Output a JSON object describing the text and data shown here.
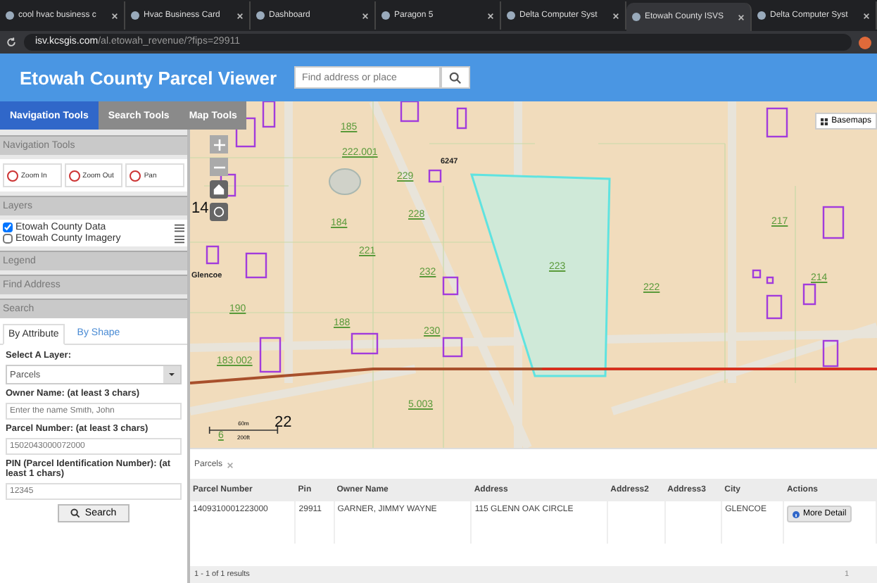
{
  "browser": {
    "tabs": [
      {
        "title": "cool hvac business c",
        "selected": false
      },
      {
        "title": "Hvac Business Card",
        "selected": false
      },
      {
        "title": "Dashboard",
        "selected": false
      },
      {
        "title": "Paragon 5",
        "selected": false
      },
      {
        "title": "Delta Computer Syst",
        "selected": false
      },
      {
        "title": "Etowah County ISVS",
        "selected": true
      },
      {
        "title": "Delta Computer Syst",
        "selected": false
      }
    ],
    "url_host": "isv.kcsgis.com",
    "url_path": "/al.etowah_revenue/?fips=29911"
  },
  "header": {
    "title": "Etowah County Parcel Viewer",
    "search_placeholder": "Find address or place"
  },
  "tool_tabs": [
    {
      "label": "Navigation Tools",
      "selected": true
    },
    {
      "label": "Search Tools",
      "selected": false
    },
    {
      "label": "Map Tools",
      "selected": false
    }
  ],
  "navigation": {
    "title": "Navigation Tools",
    "tools": [
      "Zoom In",
      "Zoom Out",
      "Pan"
    ]
  },
  "layers": {
    "title": "Layers",
    "items": [
      {
        "label": "Etowah County Data",
        "checked": true
      },
      {
        "label": "Etowah County Imagery",
        "checked": false
      }
    ]
  },
  "legend": {
    "title": "Legend"
  },
  "find_address": {
    "title": "Find Address"
  },
  "search": {
    "title": "Search",
    "tabs": [
      {
        "label": "By Attribute",
        "selected": true
      },
      {
        "label": "By Shape",
        "selected": false
      }
    ],
    "layer_label": "Select A Layer:",
    "layer_value": "Parcels",
    "fields": [
      {
        "label": "Owner Name: (at least 3 chars)",
        "placeholder": "Enter the name Smith, John"
      },
      {
        "label": "Parcel Number: (at least 3 chars)",
        "placeholder": "1502043000072000"
      },
      {
        "label": "PIN (Parcel Identification Number): (at least 1 chars)",
        "placeholder": "12345"
      }
    ],
    "button": "Search"
  },
  "map": {
    "labels": [
      "185",
      "222.001",
      "6247",
      "229",
      "14",
      "184",
      "228",
      "217",
      "221",
      "Glencoe",
      "232",
      "223",
      "222",
      "214",
      "190",
      "188",
      "230",
      "183.002",
      "5.003",
      "22",
      "6"
    ],
    "basemaps": "Basemaps",
    "scale_top": "60m",
    "scale_bottom": "200ft"
  },
  "results": {
    "tab": "Parcels",
    "columns": [
      "Parcel Number",
      "Pin",
      "Owner Name",
      "Address",
      "Address2",
      "Address3",
      "City",
      "Actions"
    ],
    "rows": [
      {
        "cells": [
          "1409310001223000",
          "29911",
          "GARNER, JIMMY WAYNE",
          "115 GLENN OAK CIRCLE",
          "",
          "",
          "GLENCOE"
        ],
        "action": "More Detail"
      }
    ],
    "summary": "1 - 1 of 1 results",
    "page": "1"
  }
}
